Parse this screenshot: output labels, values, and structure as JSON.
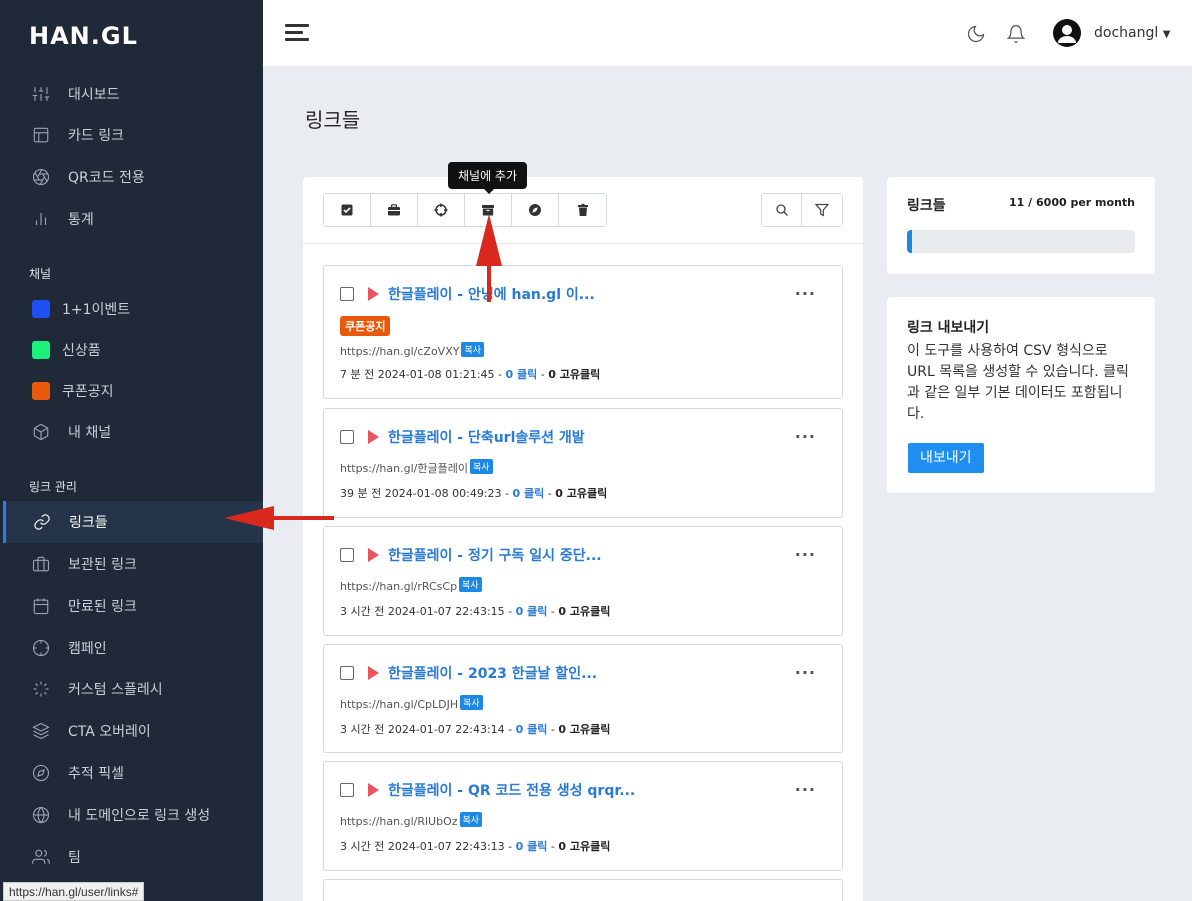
{
  "sidebar": {
    "logo": "HAN.GL",
    "items": [
      {
        "label": "대시보드",
        "icon": "sliders-icon"
      },
      {
        "label": "카드 링크",
        "icon": "layout-icon"
      },
      {
        "label": "QR코드 전용",
        "icon": "aperture-icon"
      },
      {
        "label": "통계",
        "icon": "bar-chart-icon"
      }
    ],
    "channels_label": "채널",
    "channels": [
      {
        "label": "1+1이벤트",
        "color": "#1f4ff0"
      },
      {
        "label": "신상품",
        "color": "#1bf07a"
      },
      {
        "label": "쿠폰공지",
        "color": "#e8590c"
      },
      {
        "label": "내 채널",
        "icon": "box-icon"
      }
    ],
    "links_label": "링크 관리",
    "link_items": [
      {
        "label": "링크들",
        "icon": "link-icon",
        "active": true
      },
      {
        "label": "보관된 링크",
        "icon": "briefcase-icon"
      },
      {
        "label": "만료된 링크",
        "icon": "calendar-icon"
      },
      {
        "label": "캠페인",
        "icon": "crosshair-icon"
      },
      {
        "label": "커스텀 스플레시",
        "icon": "loader-icon"
      },
      {
        "label": "CTA 오버레이",
        "icon": "layers-icon"
      },
      {
        "label": "추적 픽셀",
        "icon": "compass-icon"
      },
      {
        "label": "내 도메인으로 링크 생성",
        "icon": "globe-icon"
      },
      {
        "label": "팀",
        "icon": "users-icon"
      }
    ],
    "status_url": "https://han.gl/user/links#"
  },
  "topbar": {
    "username": "dochangl"
  },
  "page": {
    "title": "링크들",
    "tooltip": "채널에 추가"
  },
  "links": [
    {
      "title": "한글플레이 - 안녕에 han.gl 이...",
      "tag": "쿠폰공지",
      "url": "https://han.gl/cZoVXY",
      "copy": "복사",
      "time": "7 분 전 2024-01-08 01:21:45",
      "clicks": "0 클릭",
      "unique": "0 고유클릭"
    },
    {
      "title": "한글플레이 - 단축url솔루션 개발",
      "tag": "",
      "url": "https://han.gl/한글플레이",
      "copy": "복사",
      "time": "39 분 전 2024-01-08 00:49:23",
      "clicks": "0 클릭",
      "unique": "0 고유클릭"
    },
    {
      "title": "한글플레이 - 정기 구독 일시 중단...",
      "tag": "",
      "url": "https://han.gl/rRCsCp",
      "copy": "복사",
      "time": "3 시간 전 2024-01-07 22:43:15",
      "clicks": "0 클릭",
      "unique": "0 고유클릭"
    },
    {
      "title": "한글플레이 - 2023 한글날 할인...",
      "tag": "",
      "url": "https://han.gl/CpLDJH",
      "copy": "복사",
      "time": "3 시간 전 2024-01-07 22:43:14",
      "clicks": "0 클릭",
      "unique": "0 고유클릭"
    },
    {
      "title": "한글플레이 - QR 코드 전용 생성 qrqr...",
      "tag": "",
      "url": "https://han.gl/RlUbOz",
      "copy": "복사",
      "time": "3 시간 전 2024-01-07 22:43:13",
      "clicks": "0 클릭",
      "unique": "0 고유클릭"
    }
  ],
  "stats": {
    "title": "링크들",
    "count": "11 / 6000 per month",
    "progress_fraction": 0.0018
  },
  "export": {
    "title": "링크 내보내기",
    "description": "이 도구를 사용하여 CSV 형식으로 URL 목록을 생성할 수 있습니다. 클릭과 같은 일부 기본 데이터도 포함됩니다.",
    "button": "내보내기"
  }
}
